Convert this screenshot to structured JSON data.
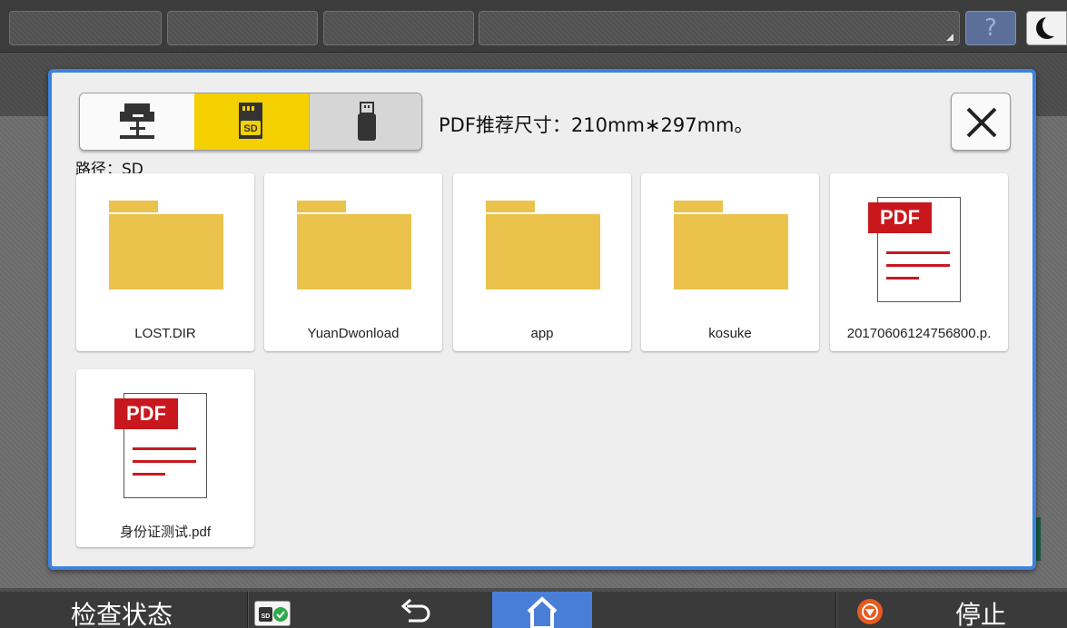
{
  "dialog": {
    "source_tabs": [
      {
        "icon": "network-server-icon",
        "selected": false
      },
      {
        "icon": "sd-card-icon",
        "label": "SD",
        "selected": true
      },
      {
        "icon": "usb-drive-icon",
        "selected": false
      }
    ],
    "hint": "PDF推荐尺寸：210mm∗297mm。",
    "path_label": "路径：SD",
    "close_icon": "close-icon",
    "files": [
      {
        "type": "folder",
        "name": "LOST.DIR"
      },
      {
        "type": "folder",
        "name": "YuanDwonload"
      },
      {
        "type": "folder",
        "name": "app"
      },
      {
        "type": "folder",
        "name": "kosuke"
      },
      {
        "type": "pdf",
        "name": "20170606124756800.p.",
        "tag": "PDF"
      },
      {
        "type": "pdf",
        "name": "身份证测试.pdf",
        "tag": "PDF"
      }
    ]
  },
  "topbar": {
    "help_label": "?",
    "sleep_icon": "moon-icon"
  },
  "bottombar": {
    "check_status": "检查状态",
    "sd_status_icon": "sd-ok-icon",
    "sd_label": "SD",
    "back_icon": "back-arrow-icon",
    "home_icon": "home-icon",
    "stop_icon": "stop-icon",
    "stop_label": "停止"
  },
  "colors": {
    "accent_blue": "#3c82e0",
    "selected_tab": "#f5d000",
    "folder": "#ebc24b",
    "pdf_red": "#c8181e",
    "stop_orange": "#e85a20"
  }
}
